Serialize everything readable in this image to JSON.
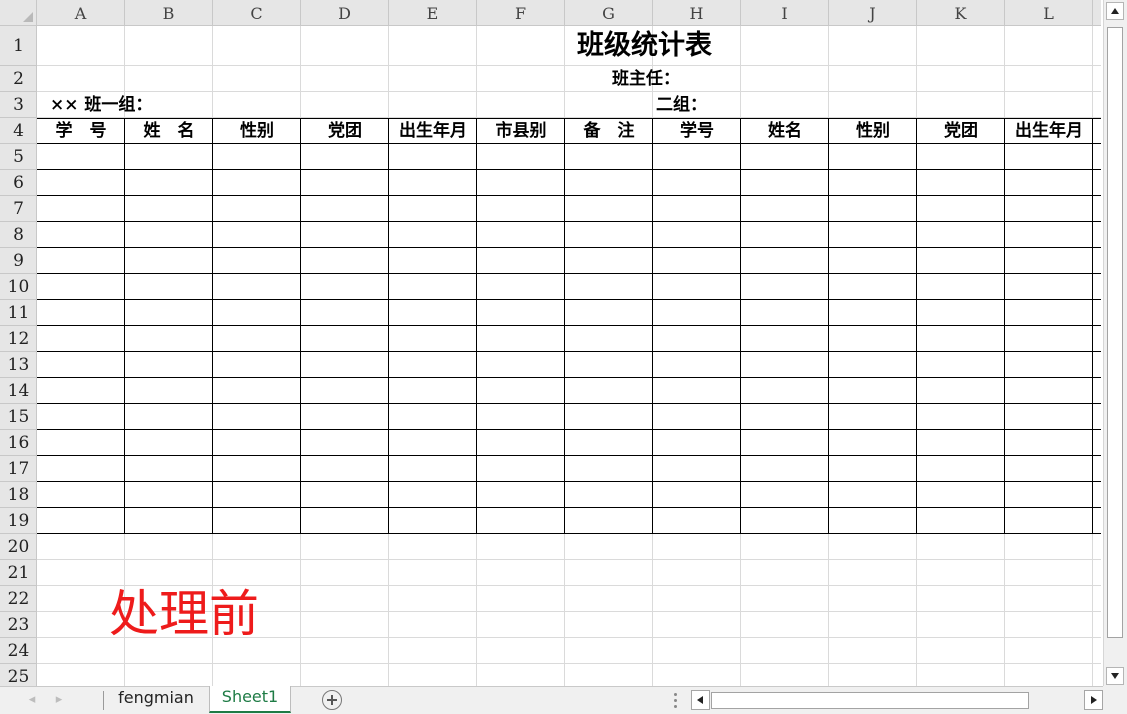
{
  "sheet": {
    "columns": [
      "A",
      "B",
      "C",
      "D",
      "E",
      "F",
      "G",
      "H",
      "I",
      "J",
      "K",
      "L"
    ],
    "rows": [
      "1",
      "2",
      "3",
      "4",
      "5",
      "6",
      "7",
      "8",
      "9",
      "10",
      "11",
      "12",
      "13",
      "14",
      "15",
      "16",
      "17",
      "18",
      "19",
      "20",
      "21",
      "22",
      "23",
      "24",
      "25"
    ],
    "title": "班级统计表",
    "head_teacher_label": "班主任：",
    "group1_label": "×× 班一组：",
    "group2_label": "二组：",
    "table_headers": [
      "学　号",
      "姓　名",
      "性别",
      "党团",
      "出生年月",
      "市县别",
      "备　注",
      "学号",
      "姓名",
      "性别",
      "党团",
      "出生年月"
    ],
    "overlay_text": "处理前"
  },
  "tabs": {
    "items": [
      {
        "label": "fengmian",
        "active": false
      },
      {
        "label": "Sheet1",
        "active": true
      }
    ],
    "prev_icon": "◂",
    "next_icon": "▸"
  },
  "colors": {
    "active_tab": "#1e7b45",
    "overlay": "#ee1b1b",
    "header_bg": "#e6e6e6"
  }
}
